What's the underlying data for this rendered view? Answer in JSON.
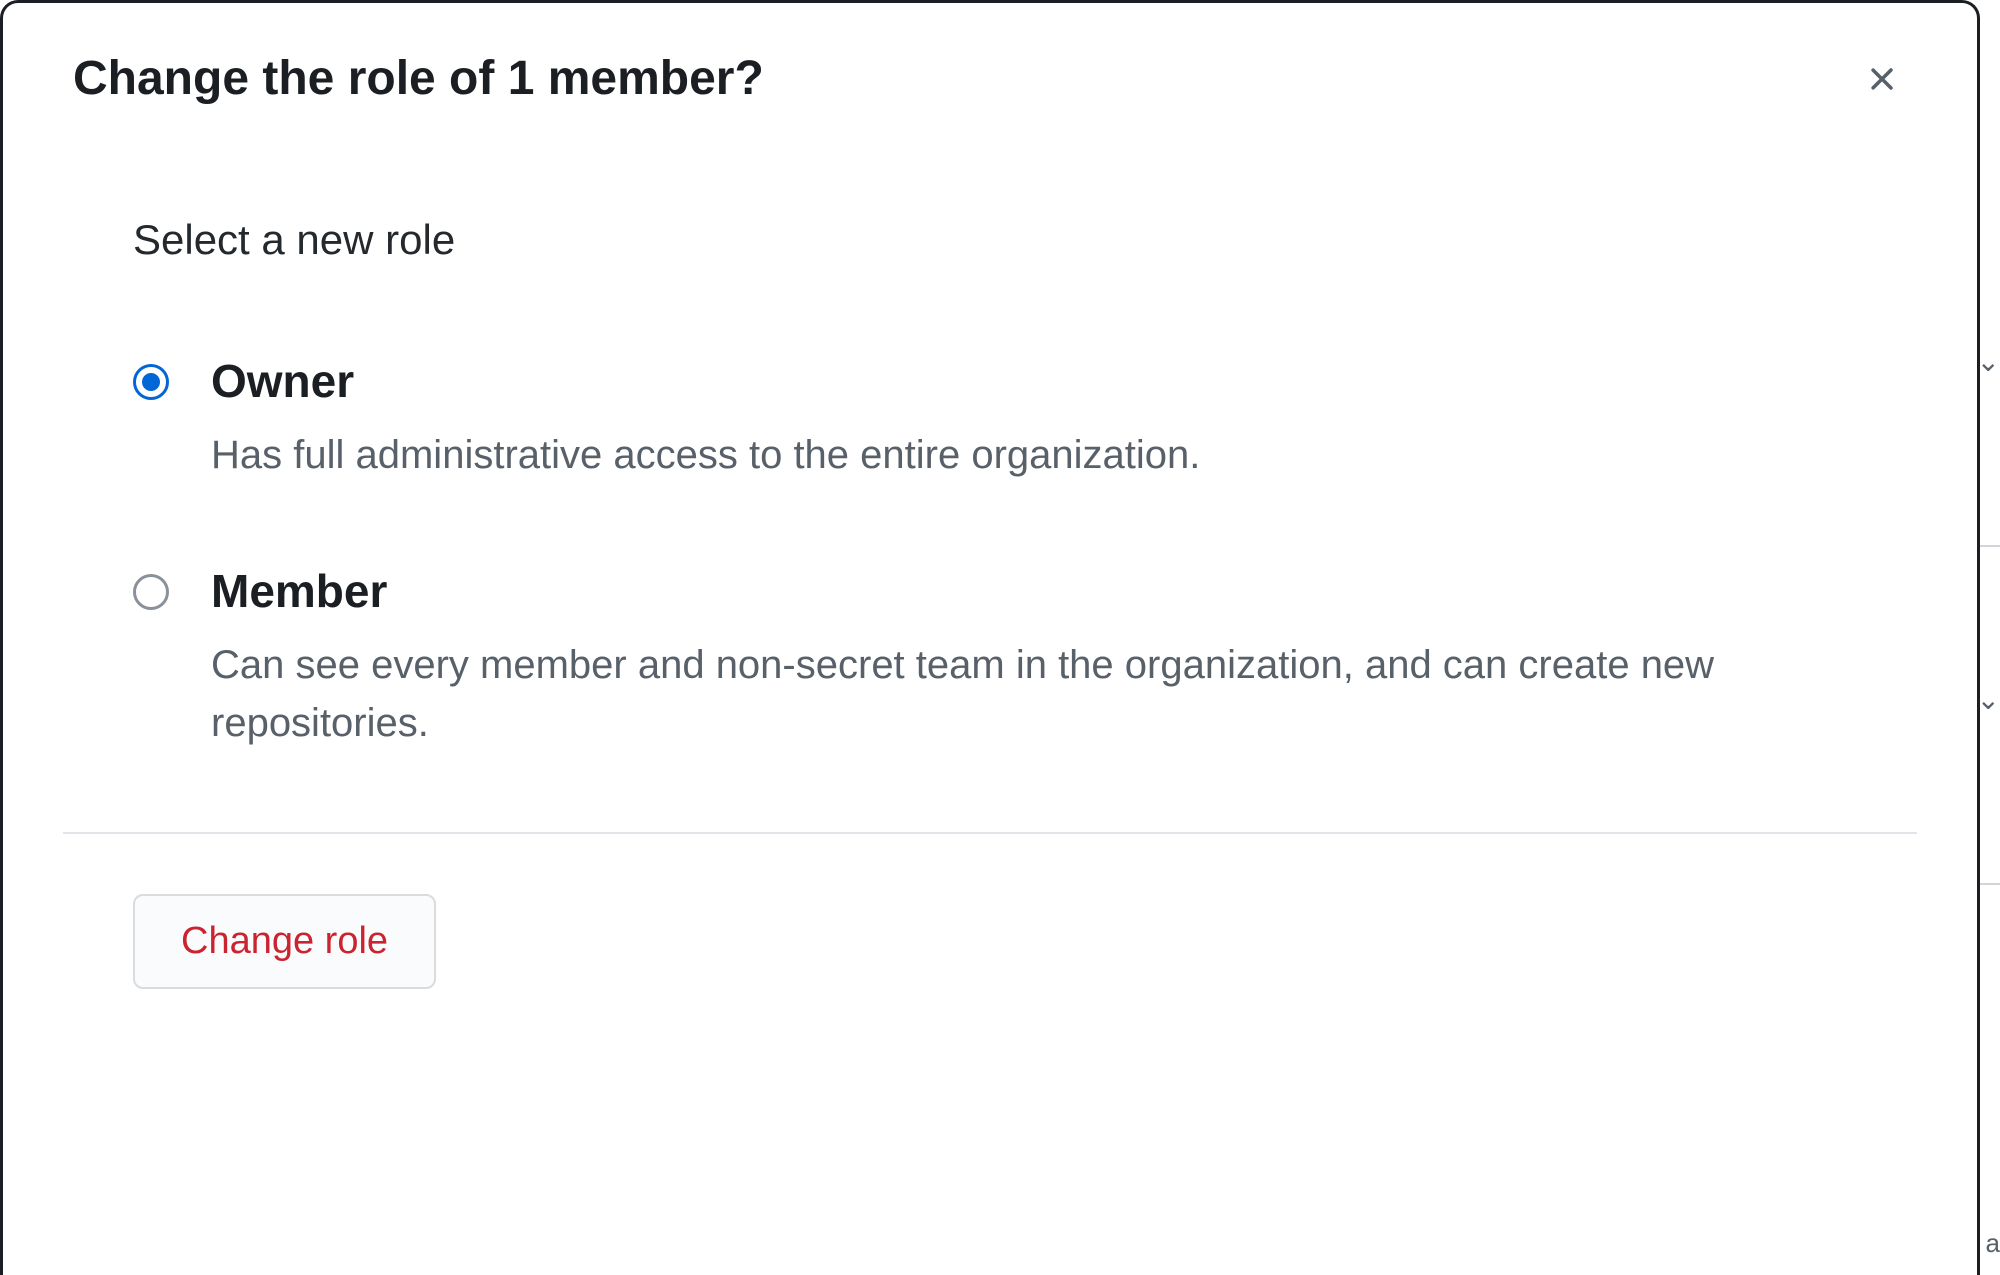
{
  "modal": {
    "title": "Change the role of 1 member?",
    "prompt": "Select a new role",
    "options": [
      {
        "label": "Owner",
        "description": "Has full administrative access to the entire organization.",
        "checked": true
      },
      {
        "label": "Member",
        "description": "Can see every member and non-secret team in the organization, and can create new repositories.",
        "checked": false
      }
    ],
    "confirm_label": "Change role"
  }
}
